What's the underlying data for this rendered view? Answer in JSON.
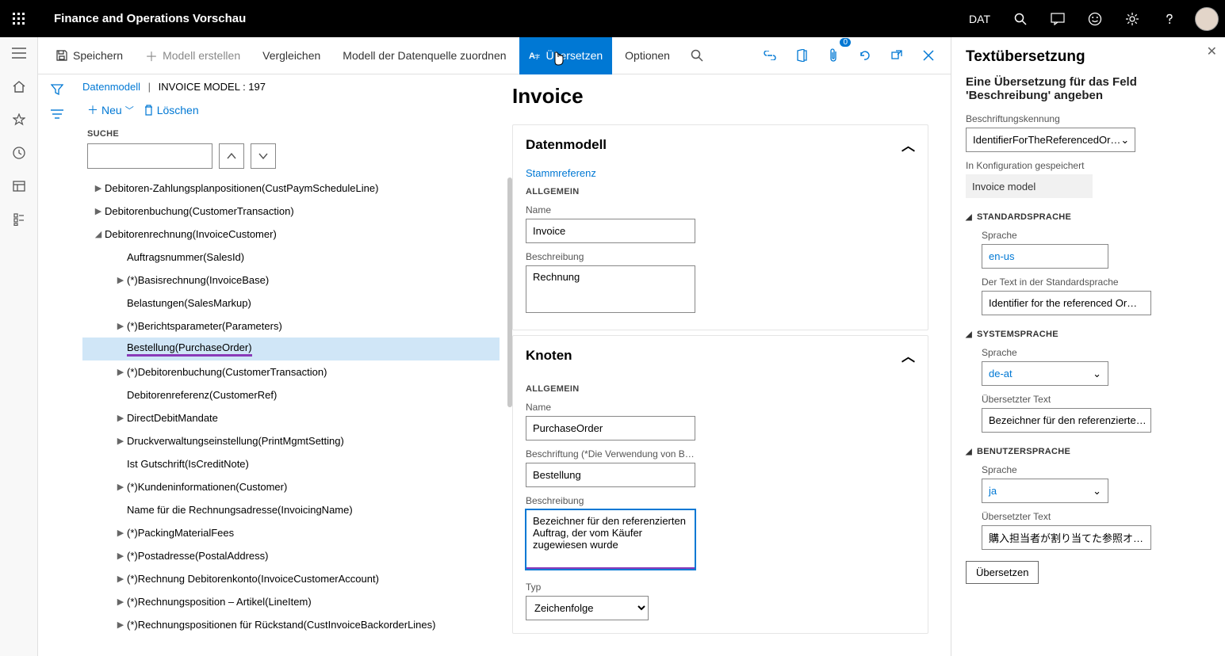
{
  "topbar": {
    "app_title": "Finance and Operations Vorschau",
    "env": "DAT"
  },
  "actionbar": {
    "save_label": "Speichern",
    "new_model_label": "Modell erstellen",
    "compare_label": "Vergleichen",
    "map_model_label": "Modell der Datenquelle zuordnen",
    "translate_label": "Übersetzen",
    "options_label": "Optionen"
  },
  "tree": {
    "breadcrumb_root": "Datenmodell",
    "breadcrumb_id": "INVOICE MODEL : 197",
    "new_label": "Neu",
    "delete_label": "Löschen",
    "search_label": "SUCHE",
    "items": [
      {
        "label": "Debitoren-Zahlungsplanpositionen(CustPaymScheduleLine)",
        "expander": "▶",
        "indent": "indent1"
      },
      {
        "label": "Debitorenbuchung(CustomerTransaction)",
        "expander": "▶",
        "indent": "indent1"
      },
      {
        "label": "Debitorenrechnung(InvoiceCustomer)",
        "expander": "◢",
        "indent": "indent1"
      },
      {
        "label": "Auftragsnummer(SalesId)",
        "expander": "",
        "indent": "indent2"
      },
      {
        "label": "(*)Basisrechnung(InvoiceBase)",
        "expander": "▶",
        "indent": "indent2"
      },
      {
        "label": "Belastungen(SalesMarkup)",
        "expander": "",
        "indent": "indent2"
      },
      {
        "label": "(*)Berichtsparameter(Parameters)",
        "expander": "▶",
        "indent": "indent2"
      },
      {
        "label": "Bestellung(PurchaseOrder)",
        "expander": "",
        "indent": "indent2",
        "selected": true
      },
      {
        "label": "(*)Debitorenbuchung(CustomerTransaction)",
        "expander": "▶",
        "indent": "indent2"
      },
      {
        "label": "Debitorenreferenz(CustomerRef)",
        "expander": "",
        "indent": "indent2"
      },
      {
        "label": "DirectDebitMandate",
        "expander": "▶",
        "indent": "indent2"
      },
      {
        "label": "Druckverwaltungseinstellung(PrintMgmtSetting)",
        "expander": "▶",
        "indent": "indent2"
      },
      {
        "label": "Ist Gutschrift(IsCreditNote)",
        "expander": "",
        "indent": "indent2"
      },
      {
        "label": "(*)Kundeninformationen(Customer)",
        "expander": "▶",
        "indent": "indent2"
      },
      {
        "label": "Name für die Rechnungsadresse(InvoicingName)",
        "expander": "",
        "indent": "indent2"
      },
      {
        "label": "(*)PackingMaterialFees",
        "expander": "▶",
        "indent": "indent2"
      },
      {
        "label": "(*)Postadresse(PostalAddress)",
        "expander": "▶",
        "indent": "indent2"
      },
      {
        "label": "(*)Rechnung Debitorenkonto(InvoiceCustomerAccount)",
        "expander": "▶",
        "indent": "indent2"
      },
      {
        "label": "(*)Rechnungsposition – Artikel(LineItem)",
        "expander": "▶",
        "indent": "indent2"
      },
      {
        "label": "(*)Rechnungspositionen für Rückstand(CustInvoiceBackorderLines)",
        "expander": "▶",
        "indent": "indent2"
      }
    ]
  },
  "details": {
    "page_title": "Invoice",
    "section1": {
      "title": "Datenmodell",
      "root_ref": "Stammreferenz",
      "general": "ALLGEMEIN",
      "name_label": "Name",
      "name_value": "Invoice",
      "desc_label": "Beschreibung",
      "desc_value": "Rechnung"
    },
    "section2": {
      "title": "Knoten",
      "general": "ALLGEMEIN",
      "name_label": "Name",
      "name_value": "PurchaseOrder",
      "caption_label": "Beschriftung (*Die Verwendung von B…",
      "caption_value": "Bestellung",
      "desc_label": "Beschreibung",
      "desc_value": "Bezeichner für den referenzierten Auftrag, der vom Käufer zugewiesen wurde",
      "type_label": "Typ",
      "type_value": "Zeichenfolge"
    }
  },
  "sidepanel": {
    "title": "Textübersetzung",
    "subtitle": "Eine Übersetzung für das Feld 'Beschreibung' angeben",
    "ident_label": "Beschriftungskennung",
    "ident_value": "IdentifierForTheReferencedOr…",
    "config_label": "In Konfiguration gespeichert",
    "config_value": "Invoice model",
    "std": {
      "header": "STANDARDSPRACHE",
      "lang_label": "Sprache",
      "lang_value": "en-us",
      "text_label": "Der Text in der Standardsprache",
      "text_value": "Identifier for the referenced Or…"
    },
    "sys": {
      "header": "SYSTEMSPRACHE",
      "lang_label": "Sprache",
      "lang_value": "de-at",
      "text_label": "Übersetzter Text",
      "text_value": "Bezeichner für den referenzierte…"
    },
    "user": {
      "header": "BENUTZERSPRACHE",
      "lang_label": "Sprache",
      "lang_value": "ja",
      "text_label": "Übersetzter Text",
      "text_value": "購入担当者が割り当てた参照オ…"
    },
    "translate_btn": "Übersetzen"
  }
}
